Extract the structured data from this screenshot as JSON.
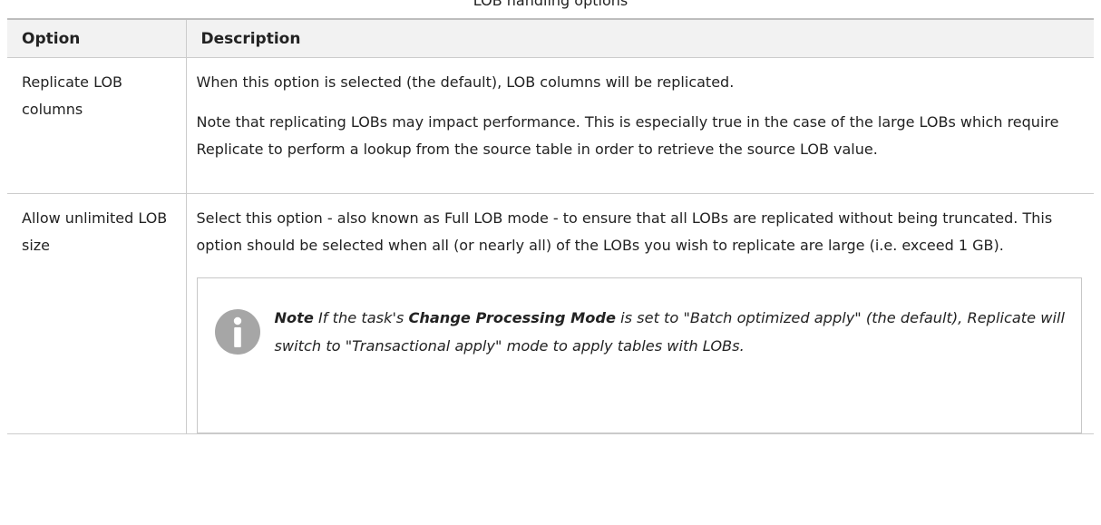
{
  "caption": "LOB handling options",
  "table": {
    "headers": [
      "Option",
      "Description"
    ],
    "rows": [
      {
        "option": "Replicate LOB columns",
        "paragraphs": [
          "When this option is selected (the default), LOB columns will be replicated.",
          "Note that replicating LOBs may impact performance. This is especially true in the case of the large LOBs which require Replicate to perform a lookup from the source table in order to retrieve the source LOB value."
        ]
      },
      {
        "option": "Allow unlimited LOB size",
        "paragraphs": [
          "Select this option - also known as Full LOB mode - to ensure that all LOBs are replicated without being truncated. This option should be selected when all (or nearly all) of the LOBs you wish to replicate are large (i.e. exceed 1 GB)."
        ],
        "note": {
          "label": "Note",
          "text_before": " If the task's ",
          "emphasis": "Change Processing Mode",
          "text_after": " is set to \"Batch optimized apply\" (the default), Replicate will switch to \"Transactional apply\" mode to apply tables with LOBs.",
          "icon": "info-icon"
        }
      }
    ]
  },
  "colors": {
    "header_bg": "#f2f2f2",
    "border": "#cccccc",
    "icon": "#a6a6a6"
  }
}
